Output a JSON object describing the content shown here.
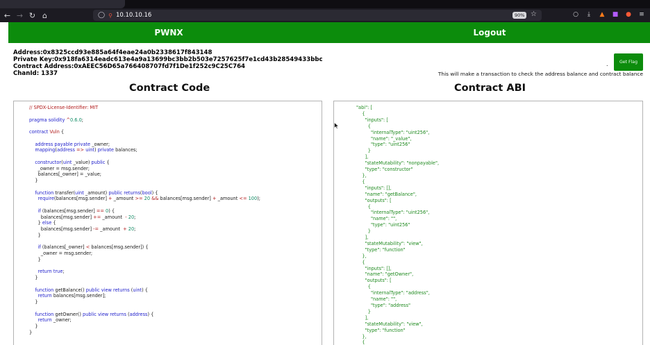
{
  "browser": {
    "url": "10.10.10.16",
    "zoom": "90%"
  },
  "header": {
    "brand": "PWNX",
    "logout": "Logout"
  },
  "info": {
    "address": "Address:0x8325ccd93e885a64f4eae24a0b2338617f843148",
    "private_key": "Private Key:0x918fa6314eadc613e4a9a13699bc3bb2b503e7257625f7e1cd43b28549433bbc",
    "contract_address": "Contract Address:0xAEEC56D65a766408707fd7f1De1f252c9C25C764",
    "chain_id": "ChanId: 1337"
  },
  "flag": {
    "button": "Get Flag",
    "dot": ".",
    "note": "This will make a transaction to check the address balance and contract balance"
  },
  "code_title": "Contract Code",
  "abi_title": "Contract ABI",
  "code_lines": [
    "// SPDX-License-Identifier: MIT",
    "",
    "pragma solidity ^0.6.0;",
    "",
    "contract Vuln {",
    "",
    "    address payable private _owner;",
    "    mapping(address => uint) private balances;",
    "",
    "    constructor(uint _value) public {",
    "      _owner = msg.sender;",
    "      balances[_owner] = _value;",
    "    }",
    "",
    "    function transfer(uint _amount) public returns(bool) {",
    "      require(balances[msg.sender] + _amount >= 20 && balances[msg.sender] + _amount <= 100);",
    "",
    "      if (balances[msg.sender] == 0) {",
    "        balances[msg.sender] += _amount  - 20;",
    "      } else {",
    "        balances[msg.sender] -= _amount  + 20;",
    "      }",
    "",
    "      if (balances[_owner] < balances[msg.sender]) {",
    "        _owner = msg.sender;",
    "      }",
    "",
    "      return true;",
    "    }",
    "",
    "    function getBalance() public view returns (uint) {",
    "      return balances[msg.sender];",
    "    }",
    "",
    "    function getOwner() public view returns (address) {",
    "      return _owner;",
    "    }",
    "}"
  ],
  "abi_lines": [
    "\"abi\": [",
    "    {",
    "      \"inputs\": [",
    "        {",
    "          \"internalType\": \"uint256\",",
    "          \"name\": \"_value\",",
    "          \"type\": \"uint256\"",
    "        }",
    "      ],",
    "      \"stateMutability\": \"nonpayable\",",
    "      \"type\": \"constructor\"",
    "    },",
    "    {",
    "      \"inputs\": [],",
    "      \"name\": \"getBalance\",",
    "      \"outputs\": [",
    "        {",
    "          \"internalType\": \"uint256\",",
    "          \"name\": \"\",",
    "          \"type\": \"uint256\"",
    "        }",
    "      ],",
    "      \"stateMutability\": \"view\",",
    "      \"type\": \"function\"",
    "    },",
    "    {",
    "      \"inputs\": [],",
    "      \"name\": \"getOwner\",",
    "      \"outputs\": [",
    "        {",
    "          \"internalType\": \"address\",",
    "          \"name\": \"\",",
    "          \"type\": \"address\"",
    "        }",
    "      ],",
    "      \"stateMutability\": \"view\",",
    "      \"type\": \"function\"",
    "    },",
    "    {"
  ]
}
